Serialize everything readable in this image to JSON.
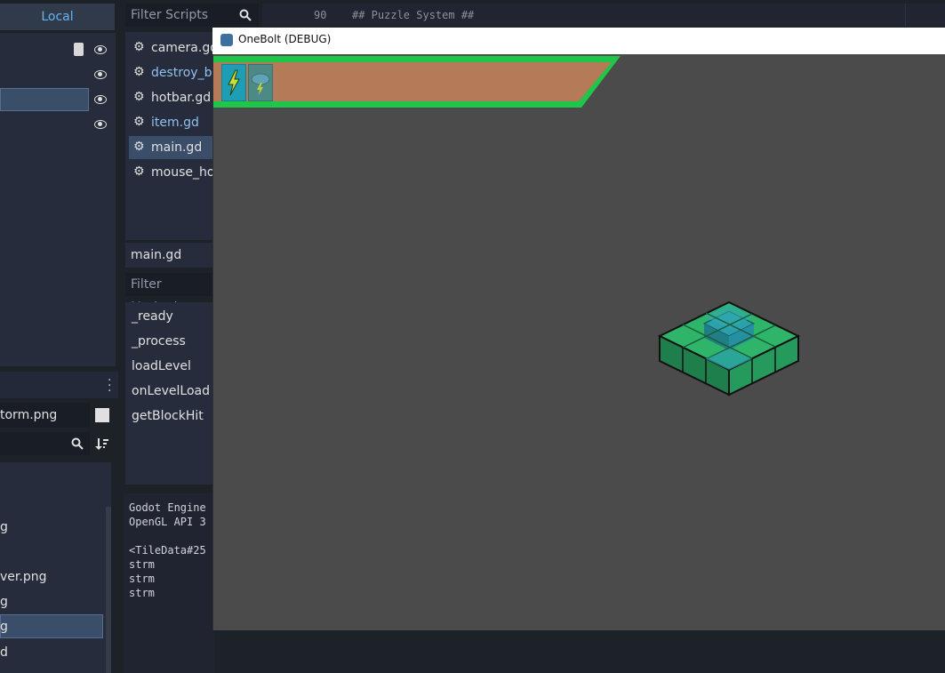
{
  "scene_dock": {
    "tab_label": "Local"
  },
  "filesystem_dock": {
    "path_field": "torm.png",
    "items": [
      {
        "label": "g"
      },
      {
        "label": "ver.png"
      },
      {
        "label": "g"
      },
      {
        "label": "g"
      },
      {
        "label": "d"
      }
    ]
  },
  "scripts": {
    "filter_placeholder": "Filter Scripts",
    "items": [
      {
        "label": "camera.gd"
      },
      {
        "label": "destroy_bl"
      },
      {
        "label": "hotbar.gd"
      },
      {
        "label": "item.gd"
      },
      {
        "label": "main.gd"
      },
      {
        "label": "mouse_ho"
      }
    ],
    "current_file": "main.gd",
    "methods_placeholder": "Filter Methods",
    "methods": [
      {
        "label": "_ready"
      },
      {
        "label": "_process"
      },
      {
        "label": "loadLevel"
      },
      {
        "label": "onLevelLoad"
      },
      {
        "label": "getBlockHit"
      }
    ]
  },
  "output": {
    "lines": [
      "Godot Engine",
      "OpenGL API 3",
      "",
      "<TileData#25",
      "strm",
      "strm",
      "strm"
    ]
  },
  "code_editor": {
    "line_number": "90",
    "line_text": "## Puzzle System ##"
  },
  "game_window": {
    "title": "OneBolt (DEBUG)",
    "hotbar": {
      "slots": [
        {
          "icon": "lightning-icon"
        },
        {
          "icon": "storm-cloud-icon"
        }
      ],
      "bar_color": "#b57b58",
      "border_color": "#1ec64a"
    }
  },
  "colors": {
    "accent": "#63b4f1",
    "selection": "#3a4d69",
    "panel": "#262c3b"
  }
}
